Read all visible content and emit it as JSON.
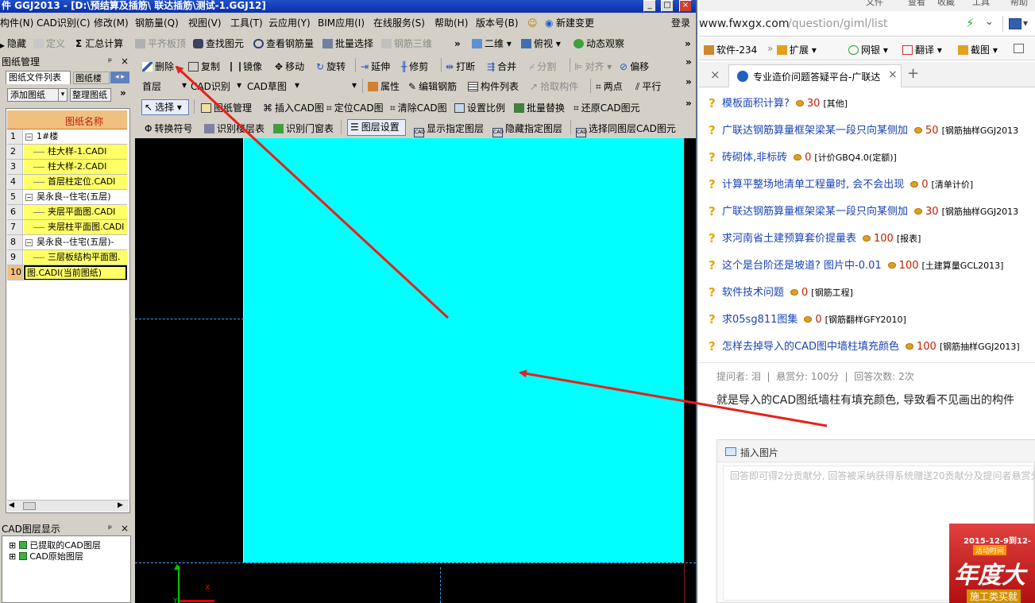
{
  "window_title": "件 GGJ2013 - [D:\\预结算及插筋\\ 联达插筋\\测试-1.GGJ12]",
  "menu": [
    "构件(N)",
    "CAD识别(C)",
    "修改(M)",
    "钢筋量(Q)",
    "视图(V)",
    "工具(T)",
    "云应用(Y)",
    "BIM应用(I)",
    "在线服务(S)",
    "帮助(H)",
    "版本号(B)",
    "新建变更"
  ],
  "login_label": "登录",
  "toolbar1": [
    "隐藏",
    "定义",
    "汇总计算",
    "平齐板顶",
    "查找图元",
    "查看钢筋量",
    "批量选择",
    "钢筋三维",
    "二维",
    "俯视",
    "动态观察"
  ],
  "toolbar2": [
    "删除",
    "复制",
    "镜像",
    "移动",
    "旋转",
    "延伸",
    "修剪",
    "打断",
    "合并",
    "分割",
    "对齐",
    "偏移"
  ],
  "toolbar3": {
    "floor": "首层",
    "cad_mode": "CAD识别",
    "cad_view": "CAD草图",
    "items": [
      "属性",
      "编辑钢筋",
      "构件列表",
      "拾取构件",
      "两点",
      "平行"
    ]
  },
  "toolbar4": [
    "选择",
    "图纸管理",
    "插入CAD图",
    "定位CAD图",
    "清除CAD图",
    "设置比例",
    "批量替换",
    "还原CAD图元"
  ],
  "toolbar5": [
    "转换符号",
    "识别楼层表",
    "识别门窗表",
    "图层设置",
    "显示指定图层",
    "隐藏指定图层",
    "选择同图层CAD图元"
  ],
  "drawing_panel": {
    "title": "图纸管理",
    "tabs": [
      "图纸文件列表",
      "图纸楼"
    ],
    "buttons": [
      "添加图纸",
      "整理图纸"
    ],
    "column": "图纸名称",
    "rows": [
      {
        "n": "1",
        "t": "1#楼",
        "lvl": 0,
        "hl": false,
        "exp": true
      },
      {
        "n": "2",
        "t": "柱大样-1.CADI",
        "lvl": 1,
        "hl": true,
        "exp": false
      },
      {
        "n": "3",
        "t": "柱大样-2.CADI",
        "lvl": 1,
        "hl": true,
        "exp": false
      },
      {
        "n": "4",
        "t": "首层柱定位.CADI",
        "lvl": 1,
        "hl": true,
        "exp": false
      },
      {
        "n": "5",
        "t": "吴永良--住宅(五层)",
        "lvl": 0,
        "hl": false,
        "exp": true
      },
      {
        "n": "6",
        "t": "夹层平面图.CADI",
        "lvl": 1,
        "hl": true,
        "exp": false
      },
      {
        "n": "7",
        "t": "夹层柱平面图.CADI",
        "lvl": 1,
        "hl": true,
        "exp": false
      },
      {
        "n": "8",
        "t": "吴永良--住宅(五层)-",
        "lvl": 0,
        "hl": false,
        "exp": true
      },
      {
        "n": "9",
        "t": "三层板结构平面图.",
        "lvl": 1,
        "hl": true,
        "exp": false
      },
      {
        "n": "10",
        "t": "图.CADI(当前图纸)",
        "lvl": 0,
        "hl": true,
        "exp": false,
        "current": true
      }
    ]
  },
  "layer_panel": {
    "title": "CAD图层显示",
    "items": [
      "已提取的CAD图层",
      "CAD原始图层"
    ]
  },
  "browser": {
    "top_menu": [
      "文件",
      "查看",
      "收藏",
      "工具",
      "帮助"
    ],
    "url_domain": "www.fwxgx.com",
    "url_path": "/question/giml/list",
    "bookmarks": [
      "软件-234",
      "扩展",
      "网银",
      "翻译",
      "截图"
    ],
    "tab_title": "专业造价问题答疑平台-广联达",
    "questions": [
      {
        "title": "模板面积计算?",
        "reward": "30",
        "tag": "[其他]"
      },
      {
        "title": "广联达钢筋算量框架梁某一段只向某侧加",
        "reward": "50",
        "tag": "[钢筋抽样GGJ2013"
      },
      {
        "title": "砖砌体,非标砖",
        "reward": "0",
        "tag": "[计价GBQ4.0(定额)]"
      },
      {
        "title": "计算平整场地清单工程量时, 会不会出现",
        "reward": "0",
        "tag": "[清单计价]"
      },
      {
        "title": "广联达钢筋算量框架梁某一段只向某侧加",
        "reward": "30",
        "tag": "[钢筋抽样GGJ2013"
      },
      {
        "title": "求河南省土建预算套价提量表",
        "reward": "100",
        "tag": "[报表]"
      },
      {
        "title": "这个是台阶还是坡道? 图片中-0.01",
        "reward": "100",
        "tag": "[土建算量GCL2013]"
      },
      {
        "title": "软件技术问题",
        "reward": "0",
        "tag": "[钢筋工程]"
      },
      {
        "title": "求05sg811图集",
        "reward": "0",
        "tag": "[钢筋翻样GFY2010]"
      },
      {
        "title": "怎样去掉导入的CAD图中墙柱填充颜色",
        "reward": "100",
        "tag": "[钢筋抽样GGJ2013]"
      }
    ],
    "meta": "提问者: 泪  |  悬赏分: 100分  |  回答次数: 2次",
    "body": "就是导入的CAD图纸墙柱有填充颜色, 导致看不见画出的构件",
    "insert_image": "插入图片",
    "answer_placeholder": "回答即可得2分贡献分, 回答被采纳获得系统赠送20贡献分及提问者悬赏分",
    "ad_date": "2015-12-9到12-",
    "ad_sub": "活动时间",
    "ad_big": "年度大",
    "ad_foot": "施工类买就"
  },
  "colors": {
    "title_bar": "#0a2fa8",
    "canvas_fill": "#00ffff",
    "arrow": "#e8201a",
    "highlight": "#ffff66",
    "link": "#1a44b8"
  }
}
